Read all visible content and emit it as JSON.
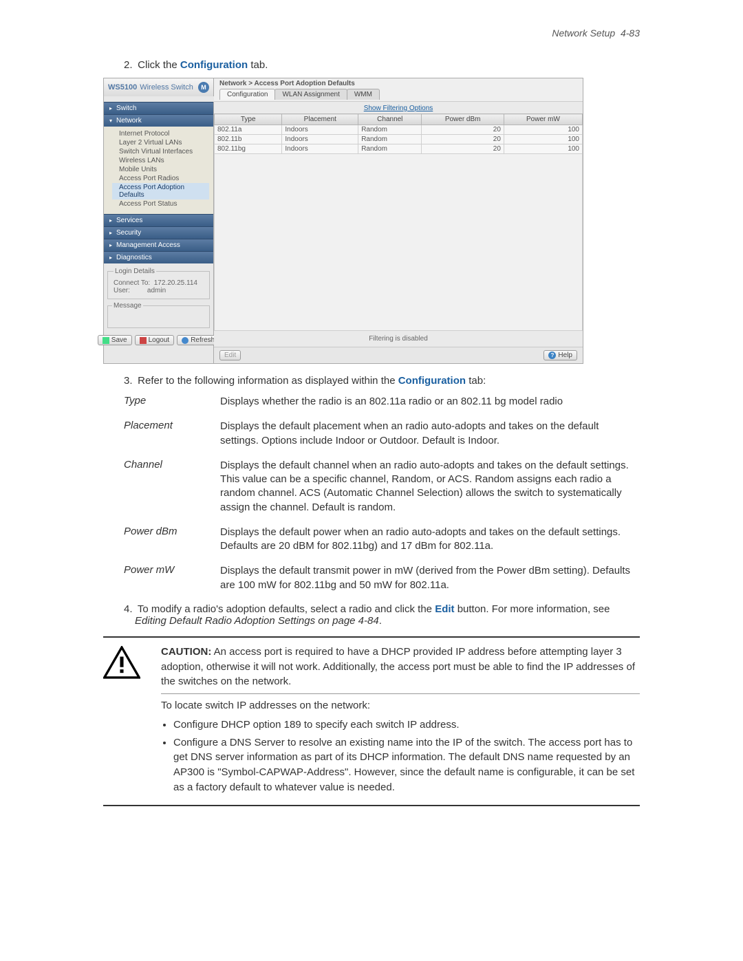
{
  "header": {
    "section": "Network Setup",
    "page": "4-83"
  },
  "steps": {
    "s2_pre": "Click the ",
    "s2_kw": "Configuration",
    "s2_post": " tab.",
    "s3_pre": "Refer to the following information as displayed within the ",
    "s3_kw": "Configuration",
    "s3_post": " tab:",
    "s4_pre": "To modify a radio's adoption defaults, select a radio and click the ",
    "s4_kw": "Edit",
    "s4_post": " button. For more information, see ",
    "s4_ref": "Editing Default Radio Adoption Settings on page 4-84"
  },
  "shot": {
    "brand": "WS5100",
    "brand_sub": " Wireless Switch",
    "logo": "M",
    "breadcrumb": "Network > Access Port Adoption Defaults",
    "tabs": [
      "Configuration",
      "WLAN Assignment",
      "WMM"
    ],
    "filter_link": "Show Filtering Options",
    "cols": [
      "Type",
      "Placement",
      "Channel",
      "Power dBm",
      "Power mW"
    ],
    "rows": [
      {
        "type": "802.11a",
        "place": "Indoors",
        "chan": "Random",
        "dbm": "20",
        "mw": "100"
      },
      {
        "type": "802.11b",
        "place": "Indoors",
        "chan": "Random",
        "dbm": "20",
        "mw": "100"
      },
      {
        "type": "802.11bg",
        "place": "Indoors",
        "chan": "Random",
        "dbm": "20",
        "mw": "100"
      }
    ],
    "filter_status": "Filtering is disabled",
    "edit_btn": "Edit",
    "help_btn": "Help",
    "nav": {
      "switch": "Switch",
      "network": "Network",
      "tree": [
        "Internet Protocol",
        "Layer 2 Virtual LANs",
        "Switch Virtual Interfaces",
        "Wireless LANs",
        "Mobile Units",
        "Access Port Radios",
        "Access Port Adoption Defaults",
        "Access Port Status"
      ],
      "services": "Services",
      "security": "Security",
      "mgmt": "Management Access",
      "diag": "Diagnostics"
    },
    "login": {
      "legend": "Login Details",
      "connect_lbl": "Connect To:",
      "connect_val": "172.20.25.114",
      "user_lbl": "User:",
      "user_val": "admin"
    },
    "msg_legend": "Message",
    "btns": {
      "save": "Save",
      "logout": "Logout",
      "refresh": "Refresh"
    }
  },
  "defs": [
    {
      "term": "Type",
      "desc": "Displays whether the radio is an 802.11a radio or an 802.11 bg model radio"
    },
    {
      "term": "Placement",
      "desc": "Displays the default placement when an radio auto-adopts and takes on the default settings. Options include Indoor or Outdoor. Default is Indoor."
    },
    {
      "term": "Channel",
      "desc": "Displays the default channel when an radio auto-adopts and takes on the default settings. This value can be a specific channel, Random, or ACS. Random assigns each radio a random channel. ACS (Automatic Channel Selection) allows the switch to systematically assign the channel. Default is random."
    },
    {
      "term": "Power dBm",
      "desc": "Displays the default power when an radio auto-adopts and takes on the default settings. Defaults are 20 dBM for 802.11bg) and 17 dBm for 802.11a."
    },
    {
      "term": "Power mW",
      "desc": "Displays the default transmit power in mW (derived from the Power dBm setting). Defaults are 100 mW for 802.11bg and 50 mW for 802.11a."
    }
  ],
  "callout": {
    "caution_lbl": "CAUTION:",
    "caution_text": " An access port is required to have a DHCP provided IP address before attempting layer 3 adoption, otherwise it will not work. Additionally, the access port must be able to find the IP addresses of the switches on the network.",
    "locate": "To locate switch IP addresses on the network:",
    "b1": "Configure DHCP option 189 to specify each switch IP address.",
    "b2": "Configure a DNS Server to resolve an existing name into the IP of the switch. The access port has to get DNS server information as part of its DHCP information. The default DNS name requested by an AP300 is \"Symbol-CAPWAP-Address\". However, since the default name is configurable, it can be set as a factory default to whatever value is needed."
  }
}
